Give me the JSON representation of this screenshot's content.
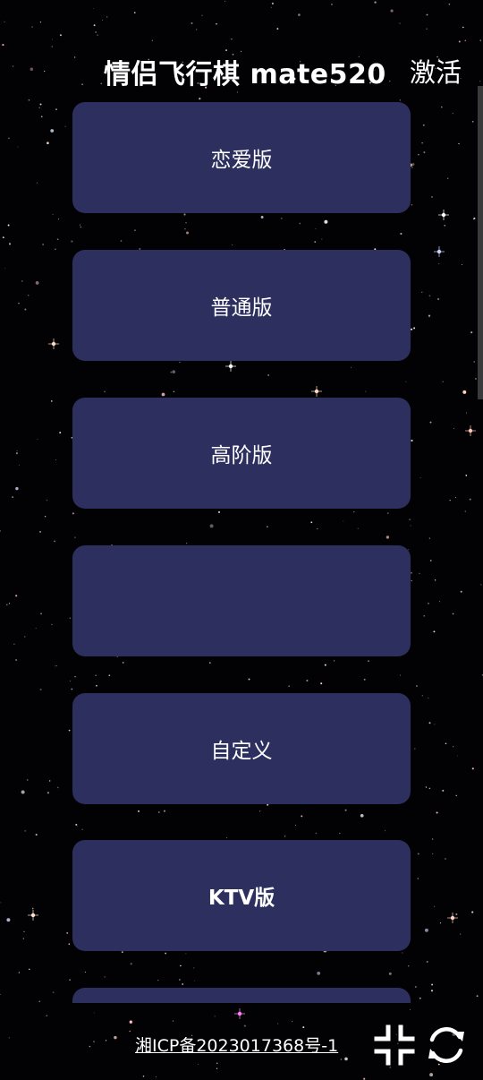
{
  "header": {
    "title": "情侣飞行棋 mate520",
    "activate_label": "激活"
  },
  "menu": {
    "items": [
      {
        "label": "恋爱版"
      },
      {
        "label": "普通版"
      },
      {
        "label": "高阶版"
      },
      {
        "label": ""
      },
      {
        "label": "自定义"
      },
      {
        "label": "KTV版"
      },
      {
        "label": ""
      }
    ]
  },
  "footer": {
    "icp_text": "湘ICP备2023017368号-1",
    "icons": [
      "collapse-fullscreen-icon",
      "refresh-icon"
    ]
  },
  "colors": {
    "background": "#020103",
    "button": "#2d2f5f",
    "text": "#ffffff"
  }
}
